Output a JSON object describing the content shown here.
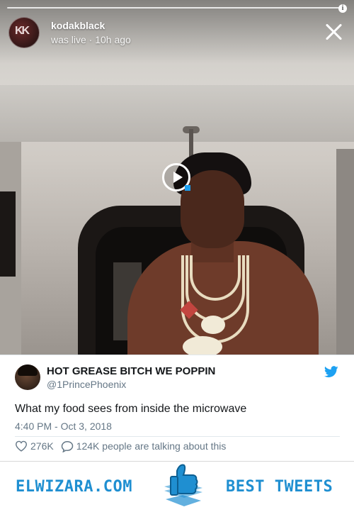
{
  "story": {
    "username": "kodakblack",
    "status": "was live · 10h ago"
  },
  "tweet": {
    "name": "HOT GREASE BITCH WE POPPIN",
    "handle": "@1PrincePhoenix",
    "text": "What my food sees from inside the microwave",
    "timestamp": "4:40 PM - Oct 3, 2018",
    "likes": "276K",
    "talking": "124K people are talking about this"
  },
  "footer": {
    "brand": "ELWIZARA.COM",
    "tagline": "BEST TWEETS"
  },
  "colors": {
    "brand_blue": "#1f8fd1",
    "twitter_blue": "#1da1f2",
    "muted": "#657786"
  }
}
